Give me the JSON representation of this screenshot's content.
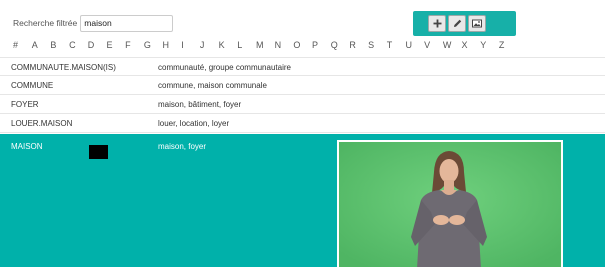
{
  "search": {
    "label": "Recherche filtrée",
    "value": "maison"
  },
  "toolbar": {
    "buttons": [
      {
        "icon": "plus-icon",
        "action": "add"
      },
      {
        "icon": "pencil-icon",
        "action": "edit"
      },
      {
        "icon": "image-icon",
        "action": "media"
      }
    ],
    "color": "#17b0a8"
  },
  "alphabet": [
    "#",
    "A",
    "B",
    "C",
    "D",
    "E",
    "F",
    "G",
    "H",
    "I",
    "J",
    "K",
    "L",
    "M",
    "N",
    "O",
    "P",
    "Q",
    "R",
    "S",
    "T",
    "U",
    "V",
    "W",
    "X",
    "Y",
    "Z"
  ],
  "entries": [
    {
      "word": "COMMUNAUTE.MAISON(IS)",
      "definition": "communauté, groupe communautaire"
    },
    {
      "word": "COMMUNE",
      "definition": "commune, maison communale"
    },
    {
      "word": "FOYER",
      "definition": "maison, bâtiment, foyer"
    },
    {
      "word": "LOUER.MAISON",
      "definition": "louer, location, loyer"
    }
  ],
  "selected_entry": {
    "word": "MAISON",
    "definition": "maison, foyer"
  },
  "colors": {
    "selection": "#00b1aa",
    "video_background": "#59c26c"
  }
}
